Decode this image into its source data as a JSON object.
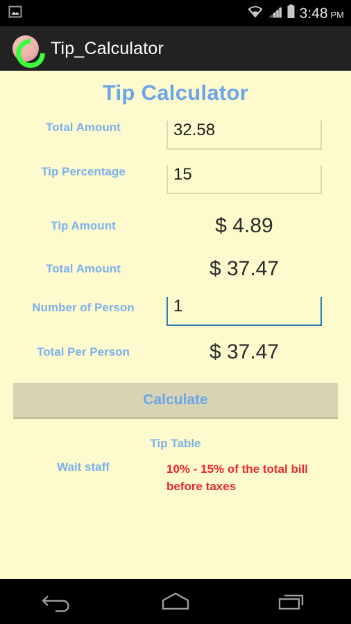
{
  "status_bar": {
    "notification_icon": "screenshot-image-icon",
    "wifi_icon": "wifi-icon",
    "signal_icon": "cellular-signal-icon",
    "battery_icon": "battery-icon",
    "time": "3:48",
    "meridiem": "PM"
  },
  "app_bar": {
    "icon": "app-logo-icon",
    "title": "Tip_Calculator"
  },
  "page": {
    "title": "Tip Calculator",
    "background_color": "#fdfbcd",
    "label_color": "#7cb0ec",
    "accent_color": "#6da4e8",
    "alert_color": "#e8262d"
  },
  "fields": [
    {
      "label": "Total Amount",
      "kind": "input",
      "value": "32.58",
      "placeholder": "",
      "focused": false
    },
    {
      "label": "Tip Percentage",
      "kind": "input",
      "value": "15",
      "placeholder": "",
      "focused": false
    },
    {
      "label": "Tip Amount",
      "kind": "result",
      "value": "$ 4.89"
    },
    {
      "label": "Total Amount",
      "kind": "result",
      "value": "$ 37.47"
    },
    {
      "label": "Number of Person",
      "kind": "input",
      "value": "1",
      "placeholder": "",
      "focused": true
    },
    {
      "label": "Total Per Person",
      "kind": "result",
      "value": "$ 37.47"
    }
  ],
  "calculate_button": {
    "label": "Calculate",
    "background_color": "#d7d4b5"
  },
  "tip_table": {
    "title": "Tip Table",
    "rows": [
      {
        "label": "Wait staff",
        "description": "10% - 15% of the total bill before taxes"
      }
    ]
  },
  "nav_bar": {
    "back": "back-icon",
    "home": "home-icon",
    "recents": "recent-apps-icon"
  }
}
